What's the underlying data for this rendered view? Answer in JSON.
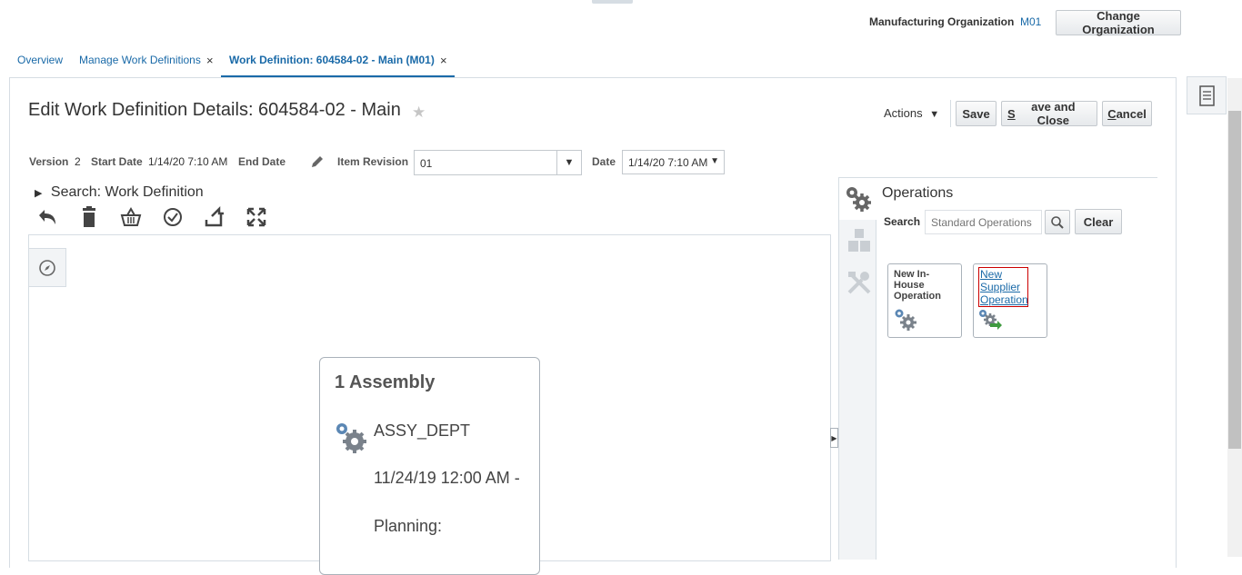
{
  "header": {
    "org_label": "Manufacturing Organization",
    "org_value": "M01",
    "change_org_button": "Change Organization"
  },
  "tabs": [
    {
      "label": "Overview",
      "closable": false
    },
    {
      "label": "Manage Work Definitions",
      "closable": true
    },
    {
      "label": "Work Definition: 604584-02 - Main (M01)",
      "closable": true,
      "active": true
    }
  ],
  "tab_close_glyph": "×",
  "page": {
    "title": "Edit Work Definition Details: 604584-02 - Main",
    "favorite_icon": "star-icon",
    "actions_label": "Actions",
    "save_label": "Save",
    "save_close_label": "Save and Close",
    "cancel_label": "Cancel"
  },
  "meta": {
    "version_label": "Version",
    "version_value": "2",
    "start_date_label": "Start Date",
    "start_date_value": "1/14/20 7:10 AM",
    "end_date_label": "End Date",
    "item_revision_label": "Item Revision",
    "item_revision_value": "01",
    "date_label": "Date",
    "date_value": "1/14/20 7:10 AM"
  },
  "search_section": {
    "label": "Search: Work Definition"
  },
  "toolbar": [
    {
      "icon": "undo-icon"
    },
    {
      "icon": "delete-icon"
    },
    {
      "icon": "basket-icon"
    },
    {
      "icon": "validate-icon"
    },
    {
      "icon": "refresh-icon"
    },
    {
      "icon": "expand-icon"
    }
  ],
  "assembly_card": {
    "title": "1 Assembly",
    "department": "ASSY_DEPT",
    "date": "11/24/19 12:00 AM -",
    "planning_label": "Planning:"
  },
  "operations_panel": {
    "title": "Operations",
    "search_label": "Search",
    "search_placeholder": "Standard Operations",
    "clear_label": "Clear",
    "tiles": [
      {
        "label_lines": [
          "New In-",
          "House",
          "Operation"
        ],
        "icon": "gears-icon"
      },
      {
        "label_lines": [
          "New",
          "Supplier",
          "Operation"
        ],
        "icon": "supplier-gears-icon"
      }
    ]
  },
  "colors": {
    "link": "#1a6aa8",
    "border": "#d6dde3",
    "rail_bg": "#f2f4f6"
  }
}
